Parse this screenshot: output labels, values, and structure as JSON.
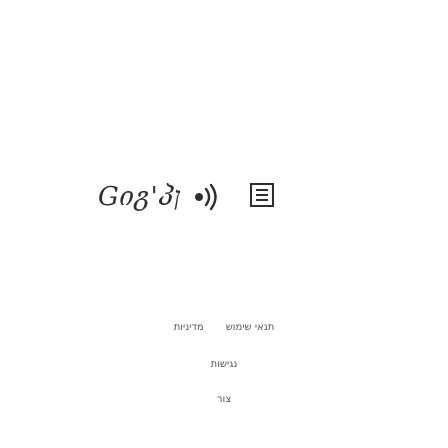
{
  "header": {
    "logo_text": "Gიგ'პן",
    "logo_icon": "sound-waves-icon",
    "menu_icon": "hamburger-menu-icon"
  },
  "footer": {
    "links_row1": [
      "תנאי שימוש",
      "מדיניות"
    ],
    "link_accessibility": "נגישות",
    "link_contact": "צור"
  }
}
